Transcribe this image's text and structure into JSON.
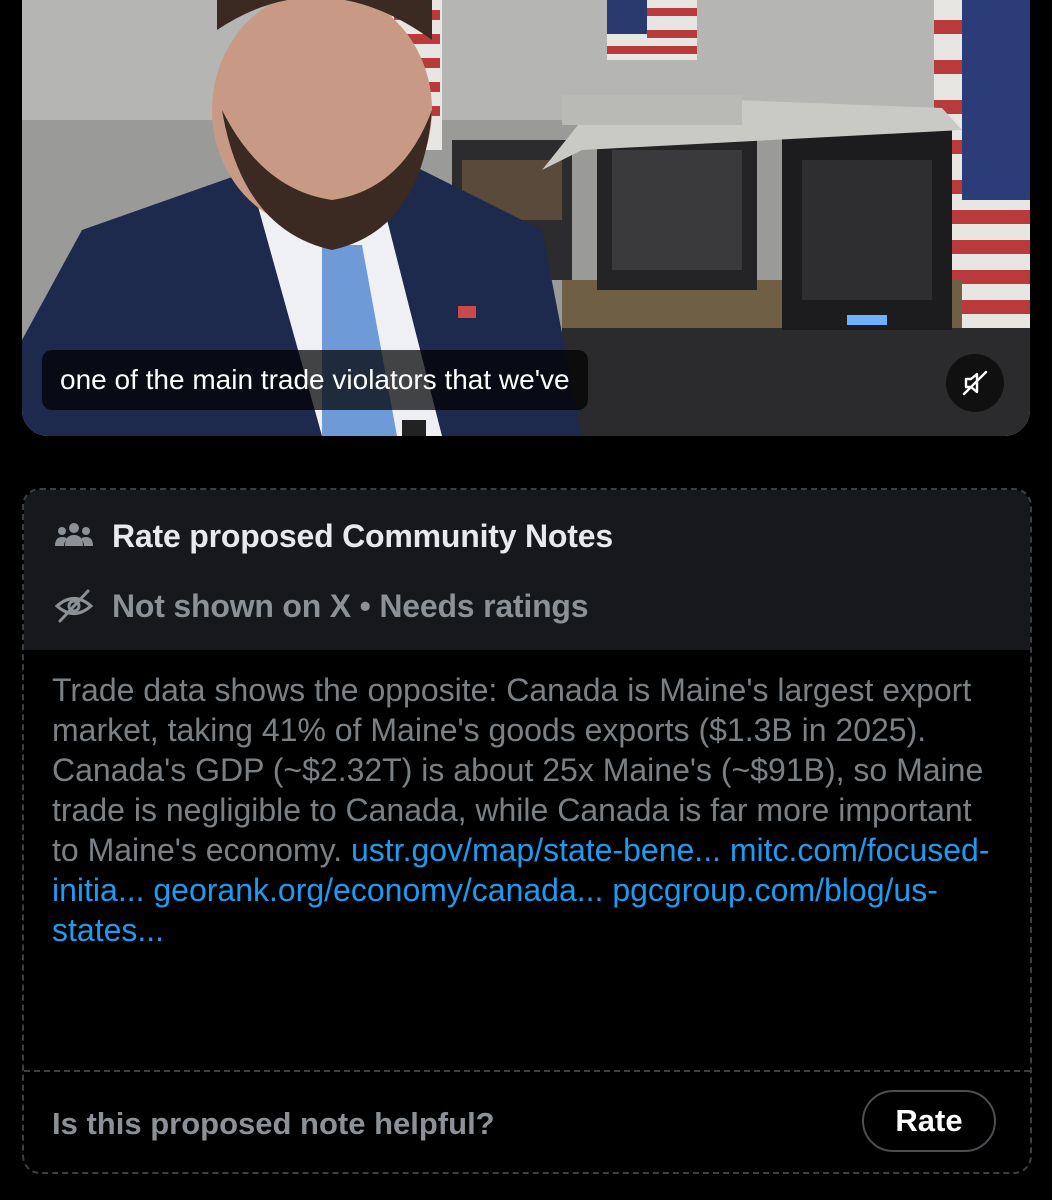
{
  "video": {
    "caption": "one of the main trade violators that we've",
    "mute_icon": "speaker-muted-icon"
  },
  "note": {
    "header_icon": "people-group-icon",
    "title": "Rate proposed Community Notes",
    "status_icon": "eye-slash-icon",
    "status": "Not shown on X • Needs ratings",
    "body_text": "Trade data shows the opposite: Canada is Maine's largest export market, taking 41% of Maine's goods exports ($1.3B in 2025). Canada's GDP (~$2.32T) is about 25x Maine's (~$91B), so Maine trade is negligible to Canada, while Canada is far more important to Maine's economy.",
    "links": [
      "ustr.gov/map/state-bene...",
      "mitc.com/focused-initia...",
      "georank.org/economy/canada...",
      "pgcgroup.com/blog/us-states..."
    ],
    "helpful_question": "Is this proposed note helpful?",
    "rate_label": "Rate"
  },
  "colors": {
    "background": "#000000",
    "header_bg": "#16181c",
    "link": "#1d9bf0",
    "body_text": "#7b8085",
    "title_text": "#e7e9ea"
  }
}
